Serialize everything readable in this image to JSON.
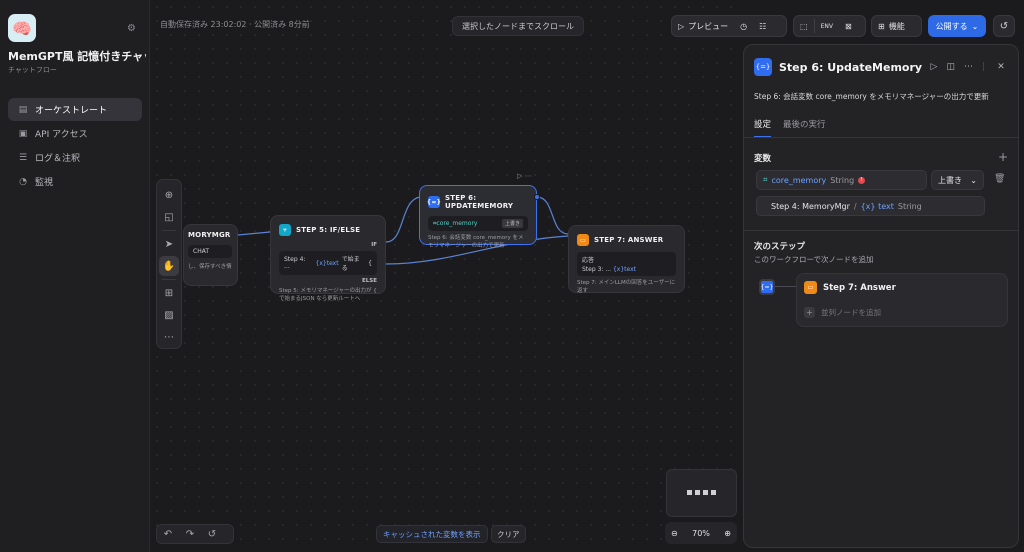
{
  "app": {
    "name": "MemGPT風 記憶付きチャッ...",
    "type": "チャットフロー",
    "icon": "brain-icon"
  },
  "sidebar": {
    "items": [
      {
        "label": "オーケストレート",
        "icon": "orchestrate-icon",
        "active": true
      },
      {
        "label": "API アクセス",
        "icon": "api-icon",
        "active": false
      },
      {
        "label": "ログ＆注釈",
        "icon": "log-icon",
        "active": false
      },
      {
        "label": "監視",
        "icon": "monitor-icon",
        "active": false
      }
    ]
  },
  "header": {
    "autosave": "自動保存済み 23:02:02 · 公開済み 8分前",
    "scroll_button": "選択したノードまでスクロール",
    "preview": "プレビュー",
    "features": "機能",
    "publish": "公開する"
  },
  "nodes": {
    "memorymgr": {
      "title": "MORYMGR",
      "chip": "CHAT",
      "desc": "し、保存すべき情"
    },
    "ifelse": {
      "title": "STEP 5: IF/ELSE",
      "if": "IF",
      "cond_src": "Step 4: ...",
      "cond_var": "text",
      "cond_op": "で始まる",
      "cond_val": "{",
      "else": "ELSE",
      "desc": "Step 5: メモリマネージャーの出力が { で始まるJSON なら更新ルートへ"
    },
    "update": {
      "title": "STEP 6: UPDATEMEMORY",
      "var": "core_memory",
      "tag": "上書き",
      "desc": "Step 6: 会話変数 core_memory をメモリマネージャーの出力で更新"
    },
    "answer": {
      "title": "STEP 7: ANSWER",
      "label": "応答",
      "ref_src": "Step 3: ...",
      "ref_var": "text",
      "desc": "Step 7: メインLLMの回答をユーザーに返す"
    }
  },
  "canvas": {
    "cache_button": "キャッシュされた変数を表示",
    "clear_button": "クリア",
    "zoom": "70%"
  },
  "panel": {
    "title": "Step 6: UpdateMemory",
    "description": "Step 6: 会話変数 core_memory をメモリマネージャーの出力で更新",
    "tabs": [
      "設定",
      "最後の実行"
    ],
    "variables_title": "変数",
    "var_name": "core_memory",
    "var_type": "String",
    "operation": "上書き",
    "source_node": "Step 4: MemoryMgr",
    "source_var": "text",
    "source_type": "String",
    "next_title": "次のステップ",
    "next_subtitle": "このワークフローで次ノードを追加",
    "next_node": "Step 7: Answer",
    "add_parallel": "並列ノードを追加"
  },
  "colors": {
    "accent": "#2e6ae6",
    "teal": "#12a6c9",
    "orange": "#f08a16",
    "error": "#e5484d"
  }
}
